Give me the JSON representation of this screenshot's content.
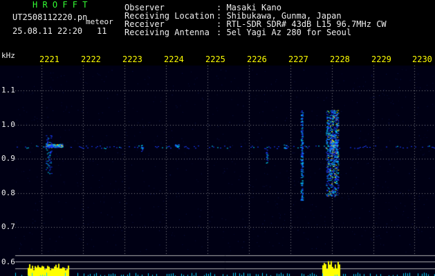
{
  "header": {
    "logo": "H R O F F T",
    "file_name": "UT2508112220.pn",
    "meteor_label": "meteor",
    "timestamp": "25.08.11 22:20",
    "meteor_count": "11"
  },
  "station_info": {
    "rows": [
      {
        "label": "Observer",
        "value": ": Masaki Kano"
      },
      {
        "label": "Receiving Location",
        "value": ": Shibukawa, Gunma, Japan"
      },
      {
        "label": "Receiver",
        "value": ": RTL-SDR SDR# 43dB L15 96.7MHz CW"
      },
      {
        "label": "Receiving Antenna",
        "value": ": 5el Yagi Az 280 for Seoul"
      }
    ]
  },
  "spectrogram": {
    "freq_unit": "kHz",
    "freq_ticks": [
      "1.1",
      "1.0",
      "0.9",
      "0.8",
      "0.7",
      "0.6"
    ],
    "time_ticks": [
      "2221",
      "2222",
      "2223",
      "2224",
      "2225",
      "2226",
      "2227",
      "2228",
      "2229",
      "2230"
    ],
    "colors": {
      "background": "#000014",
      "grid": "#8a8a8a",
      "signal_low": "#1a3cff",
      "signal_mid": "#00d7ff",
      "signal_high": "#ffff00",
      "text_green": "#33ff33",
      "text_white": "#f0f0f0",
      "text_yellow": "#ffff00"
    }
  }
}
